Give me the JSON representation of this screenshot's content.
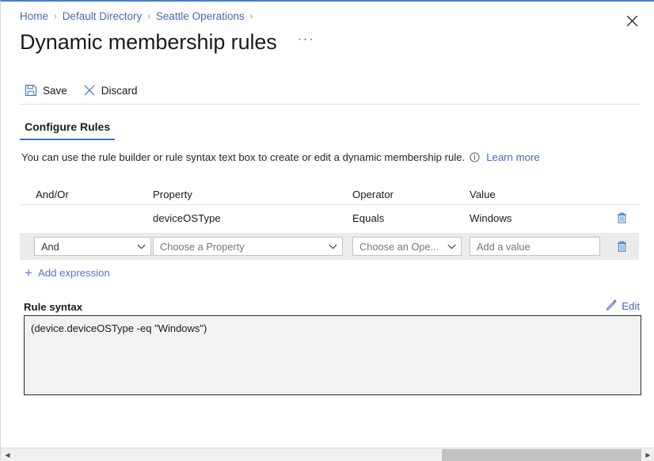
{
  "breadcrumb": {
    "items": [
      "Home",
      "Default Directory",
      "Seattle Operations"
    ],
    "separator": "›"
  },
  "header": {
    "title": "Dynamic membership rules",
    "ellipsis": "···",
    "close_label": "Close"
  },
  "commandbar": {
    "save_label": "Save",
    "save_icon": "floppy-disk-icon",
    "discard_label": "Discard",
    "discard_icon": "close-x-icon"
  },
  "tabs": [
    {
      "label": "Configure Rules",
      "active": true
    }
  ],
  "description": {
    "text": "You can use the rule builder or rule syntax text box to create or edit a dynamic membership rule.",
    "info_icon": "info-circle-icon",
    "learn_more": "Learn more"
  },
  "rule_table": {
    "headers": {
      "andor": "And/Or",
      "property": "Property",
      "operator": "Operator",
      "value": "Value"
    },
    "rows": [
      {
        "andor": "",
        "property": "deviceOSType",
        "operator": "Equals",
        "value": "Windows",
        "delete_icon": "trash-icon"
      }
    ],
    "editable_row": {
      "andor_value": "And",
      "property_placeholder": "Choose a Property",
      "operator_placeholder": "Choose an Ope...",
      "value_placeholder": "Add a value",
      "delete_icon": "trash-icon",
      "chevron_icon": "chevron-down-icon"
    }
  },
  "add_expression": {
    "label": "Add expression",
    "icon": "plus-icon"
  },
  "rule_syntax": {
    "label": "Rule syntax",
    "edit_label": "Edit",
    "edit_icon": "pencil-icon",
    "value": "(device.deviceOSType -eq \"Windows\")"
  },
  "scrollbar": {
    "left_arrow": "◀",
    "right_arrow": "▶"
  },
  "colors": {
    "accent_blue": "#3b6fc4",
    "link_blue": "#4a66b8",
    "top_border": "#4a7ec4",
    "row_highlight": "#ebebeb",
    "syntax_bg": "#f2f2f2"
  }
}
